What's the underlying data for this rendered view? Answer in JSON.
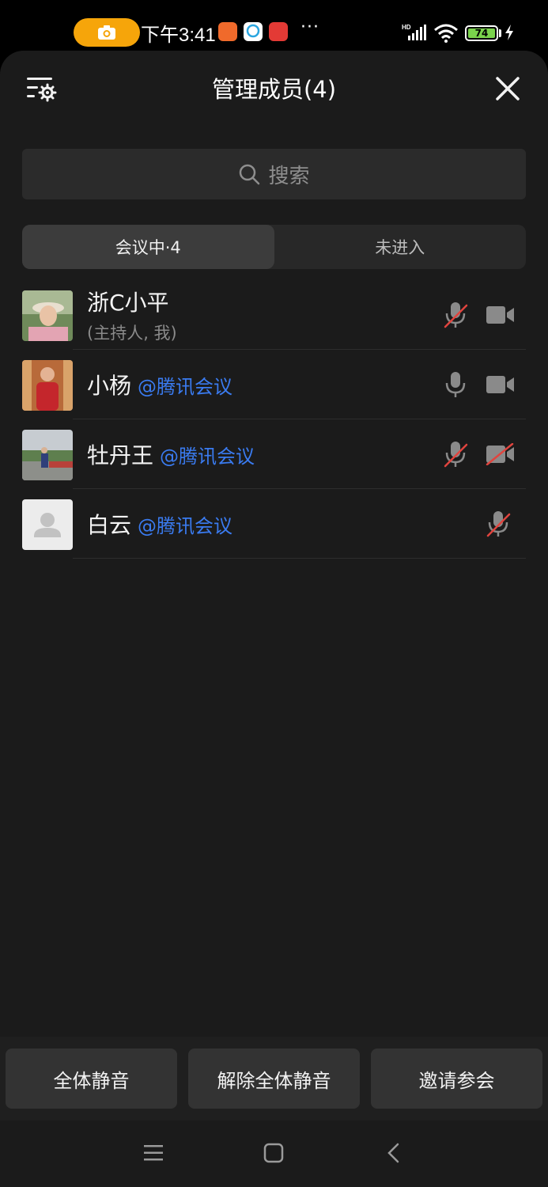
{
  "status_bar": {
    "time": "下午3:41",
    "battery": "74",
    "network": "HD",
    "icons": [
      "camera-icon",
      "app-icon-orange",
      "app-icon-chat",
      "app-icon-news",
      "more-dots",
      "signal-icon",
      "wifi-icon",
      "battery-icon",
      "charging-icon"
    ]
  },
  "header": {
    "title": "管理成员(4)",
    "settings_icon": "list-settings-icon",
    "close_icon": "close-icon"
  },
  "search": {
    "placeholder": "搜索"
  },
  "tabs": [
    {
      "label": "会议中·4",
      "active": true
    },
    {
      "label": "未进入",
      "active": false
    }
  ],
  "members": [
    {
      "name": "浙C小平",
      "tag": "",
      "sub": "(主持人, 我)",
      "mic": "muted",
      "camera": "on"
    },
    {
      "name": "小杨",
      "tag": "@腾讯会议",
      "sub": "",
      "mic": "on",
      "camera": "on"
    },
    {
      "name": "牡丹王",
      "tag": "@腾讯会议",
      "sub": "",
      "mic": "muted",
      "camera": "off"
    },
    {
      "name": "白云",
      "tag": "@腾讯会议",
      "sub": "",
      "mic": "muted",
      "camera": "none"
    }
  ],
  "actions": {
    "mute_all": "全体静音",
    "unmute_all": "解除全体静音",
    "invite": "邀请参会"
  },
  "colors": {
    "background": "#1b1b1b",
    "accent_blue": "#3a7bf0",
    "muted_red": "#e0443e",
    "pill_orange": "#f6a50a"
  }
}
